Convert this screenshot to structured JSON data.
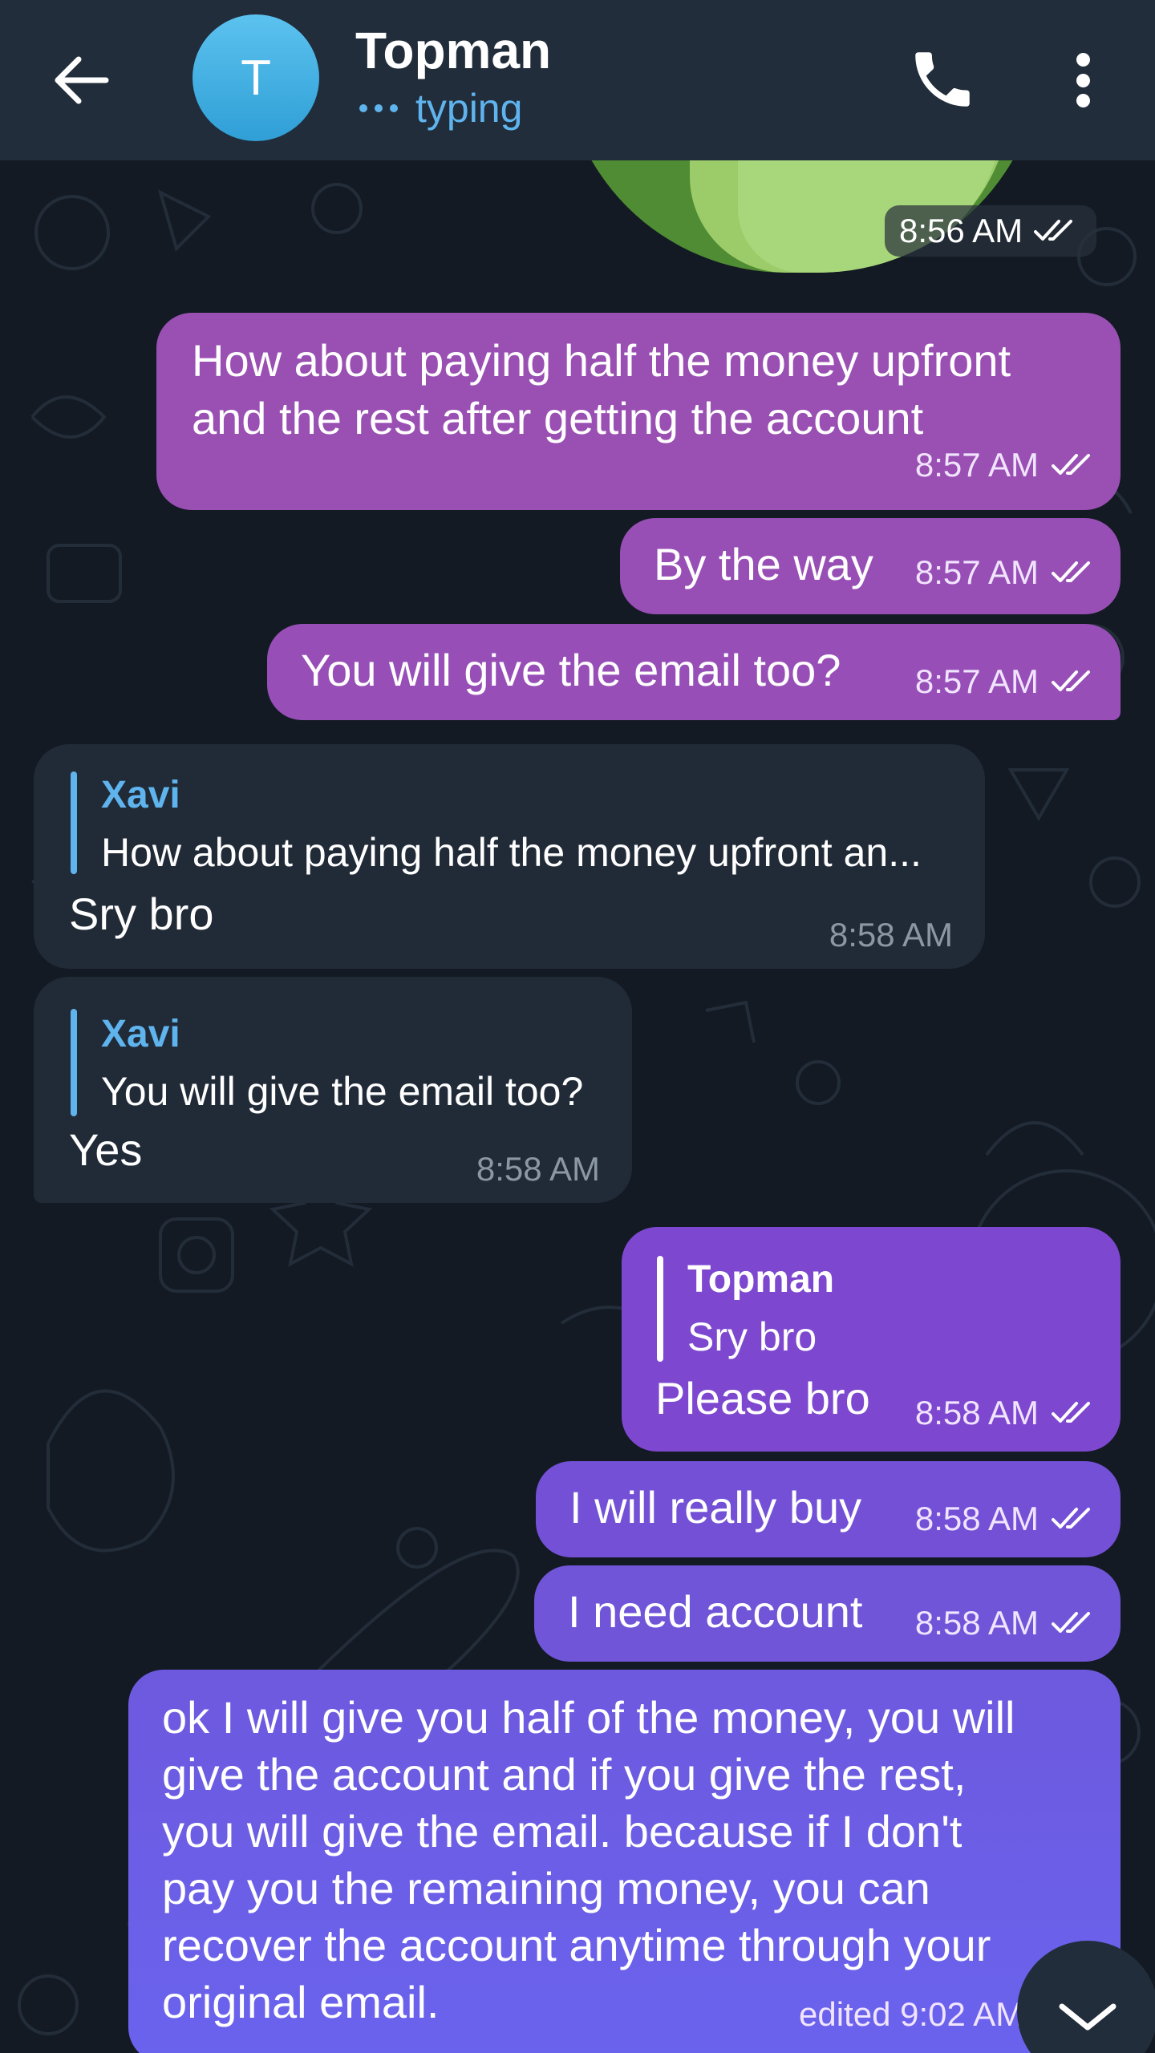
{
  "header": {
    "avatar_letter": "T",
    "contact_name": "Topman",
    "status": "typing"
  },
  "colors": {
    "header_bg": "#212d3b",
    "chat_bg": "#131a24",
    "outgoing_bubble_start": "#9a4fb3",
    "outgoing_bubble_end": "#6a63ee",
    "incoming_bubble": "#212b38",
    "accent_blue": "#5fb4ee",
    "avatar": "#3aa8e0"
  },
  "messages": {
    "sticker_time": "8:56 AM",
    "m1": {
      "text_lines": [
        "How about paying half the money upfront",
        "and the rest after getting the account"
      ],
      "time": "8:57 AM"
    },
    "m2": {
      "text": "By the way",
      "time": "8:57 AM"
    },
    "m3": {
      "text": "You will give the email too?",
      "time": "8:57 AM"
    },
    "m4": {
      "reply_name": "Xavi",
      "reply_text": "How about paying half the money upfront an...",
      "text": "Sry bro",
      "time": "8:58 AM"
    },
    "m5": {
      "reply_name": "Xavi",
      "reply_text": "You will give the email too?",
      "text": "Yes",
      "time": "8:58 AM"
    },
    "m6": {
      "reply_name": "Topman",
      "reply_text": "Sry bro",
      "text": "Please bro",
      "time": "8:58 AM"
    },
    "m7": {
      "text": "I will really buy",
      "time": "8:58 AM"
    },
    "m8": {
      "text": "I need account",
      "time": "8:58 AM"
    },
    "m9": {
      "text_lines": [
        "ok I will give you half of the money, you will",
        "give the account and if you give the rest,",
        "you will give the email. because if I don't",
        "pay you the remaining money, you can",
        "recover the account anytime through your",
        "original email."
      ],
      "time": "edited 9:02 AM"
    }
  },
  "icons": {
    "back": "arrow-left-icon",
    "call": "phone-icon",
    "menu": "more-vertical-icon",
    "read": "double-check-icon",
    "scroll": "chevron-down-icon"
  }
}
